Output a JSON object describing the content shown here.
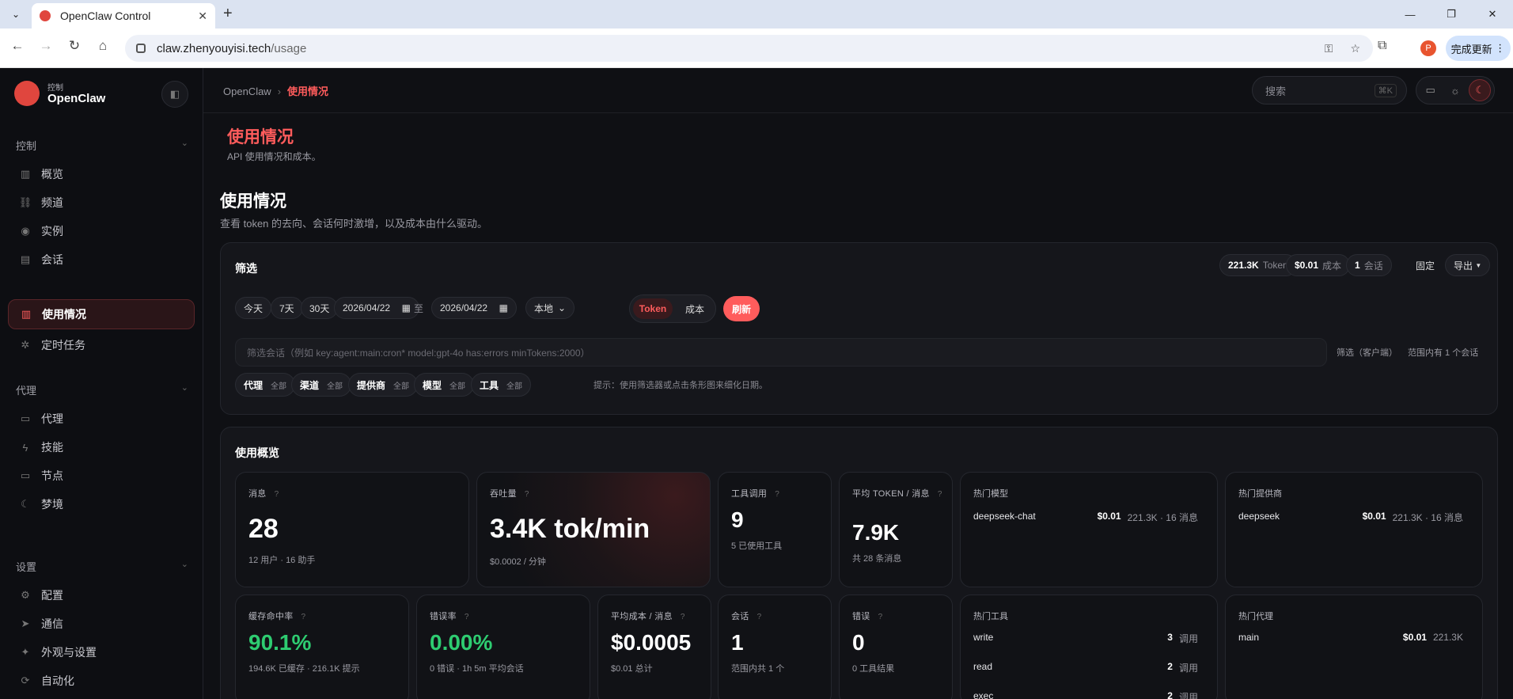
{
  "browser": {
    "tab_title": "OpenClaw Control",
    "url_host": "claw.zhenyouyisi.tech",
    "url_path": "/usage",
    "profile_initial": "P",
    "update_label": "完成更新"
  },
  "sidebar": {
    "brand_sub": "控制",
    "brand": "OpenClaw",
    "sections": [
      {
        "label": "控制",
        "items": [
          "概览",
          "频道",
          "实例",
          "会话",
          "使用情况",
          "定时任务"
        ]
      },
      {
        "label": "代理",
        "items": [
          "代理",
          "技能",
          "节点",
          "梦境"
        ]
      },
      {
        "label": "设置",
        "items": [
          "配置",
          "通信",
          "外观与设置",
          "自动化"
        ]
      }
    ],
    "active_item": "使用情况"
  },
  "topbar": {
    "breadcrumb_root": "OpenClaw",
    "breadcrumb_current": "使用情况",
    "search_placeholder": "搜索",
    "search_shortcut": "⌘K"
  },
  "page": {
    "title": "使用情况",
    "subtitle": "API 使用情况和成本。",
    "section_title": "使用情况",
    "section_subtitle": "查看 token 的去向、会话何时激增，以及成本由什么驱动。"
  },
  "filters": {
    "title": "筛选",
    "summary": {
      "tokens_value": "221.3K",
      "tokens_label": "Token",
      "cost_value": "$0.01",
      "cost_label": "成本",
      "sessions_value": "1",
      "sessions_label": "会话"
    },
    "pin_label": "固定",
    "export_label": "导出",
    "presets": [
      "今天",
      "7天",
      "30天"
    ],
    "date_from": "2026/04/22",
    "date_to": "2026/04/22",
    "date_sep": "至",
    "timezone": "本地",
    "mode_token": "Token",
    "mode_cost": "成本",
    "refresh_label": "刷新",
    "query_placeholder": "筛选会话（例如 key:agent:main:cron* model:gpt-4o has:errors minTokens:2000）",
    "client_filter": "筛选（客户端）",
    "range_info": "范围内有 1 个会话",
    "chips": [
      {
        "label": "代理",
        "value": "全部"
      },
      {
        "label": "渠道",
        "value": "全部"
      },
      {
        "label": "提供商",
        "value": "全部"
      },
      {
        "label": "模型",
        "value": "全部"
      },
      {
        "label": "工具",
        "value": "全部"
      }
    ],
    "hint": "提示：使用筛选器或点击条形图来细化日期。"
  },
  "overview": {
    "title": "使用概览",
    "cards": {
      "messages": {
        "label": "消息",
        "value": "28",
        "sub": "12 用户 · 16 助手"
      },
      "throughput": {
        "label": "吞吐量",
        "value": "3.4K tok/min",
        "sub": "$0.0002 / 分钟"
      },
      "tool_calls": {
        "label": "工具调用",
        "value": "9",
        "sub": "5 已使用工具"
      },
      "avg_tokens": {
        "label": "平均 TOKEN / 消息",
        "value": "7.9K",
        "sub": "共 28 条消息"
      },
      "cache_hit": {
        "label": "缓存命中率",
        "value": "90.1%",
        "sub": "194.6K 已缓存 · 216.1K 提示"
      },
      "error_rate": {
        "label": "错误率",
        "value": "0.00%",
        "sub": "0 错误 · 1h 5m 平均会话"
      },
      "avg_cost": {
        "label": "平均成本 / 消息",
        "value": "$0.0005",
        "sub": "$0.01 总计"
      },
      "sessions": {
        "label": "会话",
        "value": "1",
        "sub": "范围内共 1 个"
      },
      "errors": {
        "label": "错误",
        "value": "0",
        "sub": "0 工具结果"
      }
    },
    "top_models": {
      "title": "热门模型",
      "rows": [
        {
          "name": "deepseek-chat",
          "cost": "$0.01",
          "meta": "221.3K · 16 消息"
        }
      ]
    },
    "top_providers": {
      "title": "热门提供商",
      "rows": [
        {
          "name": "deepseek",
          "cost": "$0.01",
          "meta": "221.3K · 16 消息"
        }
      ]
    },
    "top_tools": {
      "title": "热门工具",
      "rows": [
        {
          "name": "write",
          "count": "3",
          "unit": "调用"
        },
        {
          "name": "read",
          "count": "2",
          "unit": "调用"
        },
        {
          "name": "exec",
          "count": "2",
          "unit": "调用"
        }
      ]
    },
    "top_agents": {
      "title": "热门代理",
      "rows": [
        {
          "name": "main",
          "cost": "$0.01",
          "meta": "221.3K"
        }
      ]
    }
  }
}
